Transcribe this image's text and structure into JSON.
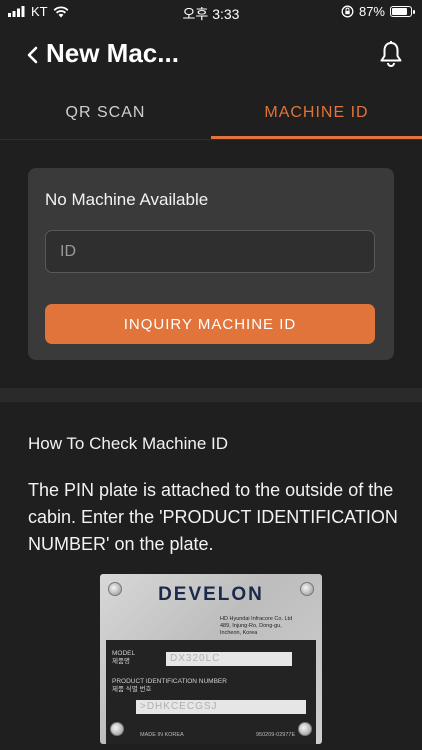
{
  "status_bar": {
    "carrier": "KT",
    "time": "오후 3:33",
    "battery_percent_label": "87%",
    "battery_level": 0.87,
    "icons": [
      "cellular-signal-icon",
      "wifi-icon",
      "orientation-lock-icon",
      "battery-icon"
    ]
  },
  "header": {
    "title": "New Mac...",
    "icons": [
      "chevron-left-icon",
      "bell-icon"
    ]
  },
  "tabs": [
    {
      "label": "QR SCAN",
      "active": false
    },
    {
      "label": "MACHINE ID",
      "active": true
    }
  ],
  "card": {
    "title": "No Machine Available",
    "id_input": {
      "value": "",
      "placeholder": "ID"
    },
    "button_label": "INQUIRY MACHINE ID"
  },
  "howto": {
    "title": "How To Check Machine ID",
    "body": "The PIN plate is attached to the outside of the cabin. Enter the 'PRODUCT IDENTIFICATION NUMBER' on the plate."
  },
  "plate": {
    "brand": "DEVELON",
    "company_line1": "HD Hyundai Infracore Co. Ltd",
    "company_line2": "489, Injung-Ro, Dong-gu,",
    "company_line3": "Incheon, Korea",
    "model_label": "MODEL",
    "model_label_kr": "제품명",
    "model_value": "DX320LC",
    "pin_label": "PRODUCT IDENTIFICATION NUMBER",
    "pin_label_kr": "제품 식별 번호",
    "pin_value": ">DHKCECGSJ",
    "made_in": "MADE IN KOREA",
    "part_no": "950209-02977E"
  },
  "colors": {
    "background": "#1f1f1f",
    "card": "#3a3a3a",
    "accent": "#e0743a"
  }
}
